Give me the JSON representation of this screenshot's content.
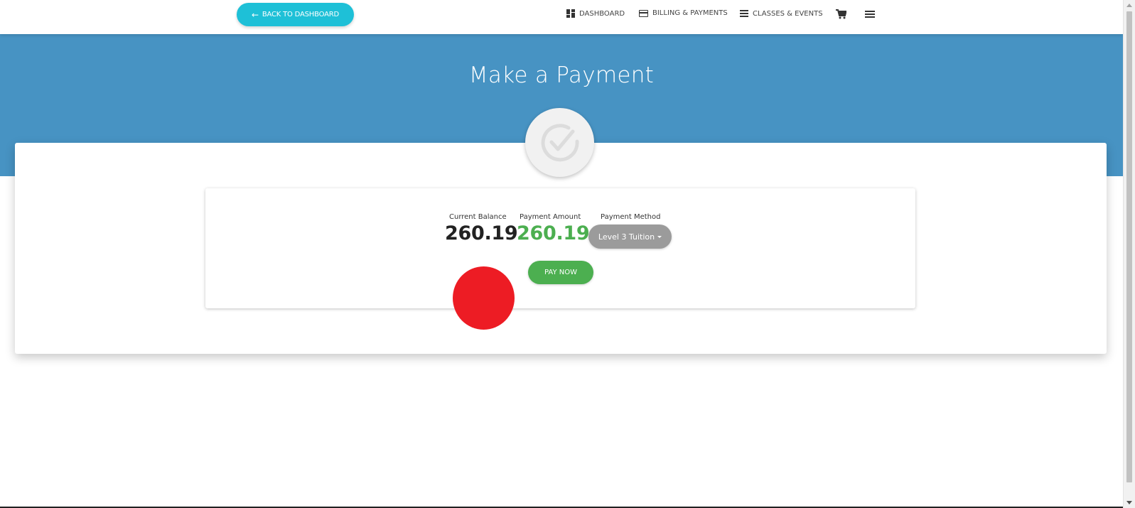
{
  "nav": {
    "back_label": "BACK TO DASHBOARD",
    "items": [
      {
        "label": "DASHBOARD",
        "icon": "dashboard-icon"
      },
      {
        "label": "BILLING & PAYMENTS",
        "icon": "credit-card-icon"
      },
      {
        "label": "CLASSES & EVENTS",
        "icon": "list-icon"
      }
    ],
    "cart_icon": "cart-icon",
    "menu_icon": "hamburger-menu-icon"
  },
  "hero": {
    "title": "Make a Payment",
    "badge_icon": "checkmark-circle-icon"
  },
  "payment": {
    "current_balance_label": "Current Balance",
    "current_balance": "260.19",
    "payment_amount_label": "Payment Amount",
    "payment_amount": "260.19",
    "payment_method_label": "Payment Method",
    "payment_method_selected": "Level 3 Tuition",
    "pay_now_label": "PAY NOW"
  },
  "colors": {
    "hero_bg": "#4793c3",
    "back_button": "#1ec0d7",
    "pay_button": "#4caf50",
    "amount_green": "#4caf50",
    "method_button": "#9b9b9b",
    "marker": "#ed1c24"
  }
}
